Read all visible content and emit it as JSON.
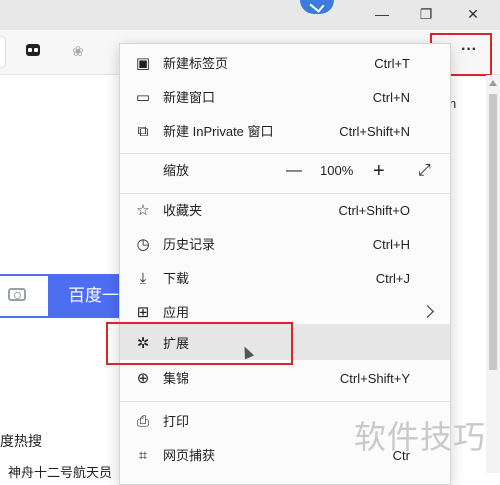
{
  "window": {
    "minimize_glyph": "—",
    "restore_glyph": "❐",
    "close_glyph": "✕"
  },
  "toolbar": {
    "more_label": "···"
  },
  "page": {
    "side_text": "n",
    "search_button": "百度一",
    "hot_search": "度热搜",
    "news_snippet": "神舟十二号航天员"
  },
  "menu": {
    "items": [
      {
        "icon": "new-tab-icon",
        "label": "新建标签页",
        "shortcut": "Ctrl+T"
      },
      {
        "icon": "new-window-icon",
        "label": "新建窗口",
        "shortcut": "Ctrl+N"
      },
      {
        "icon": "inprivate-icon",
        "label": "新建 InPrivate 窗口",
        "shortcut": "Ctrl+Shift+N"
      },
      {
        "label": "缩放",
        "minus": "—",
        "value": "100%",
        "plus": "+",
        "expand": "⤢"
      },
      {
        "icon": "favorites-icon",
        "label": "收藏夹",
        "shortcut": "Ctrl+Shift+O"
      },
      {
        "icon": "history-icon",
        "label": "历史记录",
        "shortcut": "Ctrl+H"
      },
      {
        "icon": "download-icon",
        "label": "下载",
        "shortcut": "Ctrl+J"
      },
      {
        "icon": "apps-icon",
        "label": "应用"
      },
      {
        "icon": "extensions-icon",
        "label": "扩展"
      },
      {
        "icon": "collections-icon",
        "label": "集锦",
        "shortcut": "Ctrl+Shift+Y"
      },
      {
        "icon": "print-icon",
        "label": "打印"
      },
      {
        "icon": "web-capture-icon",
        "label": "网页捕获",
        "shortcut": "Ctr"
      }
    ]
  },
  "watermark": "软件技巧",
  "colors": {
    "highlight": "#d8262b",
    "baidu_blue": "#4e6ef2"
  }
}
